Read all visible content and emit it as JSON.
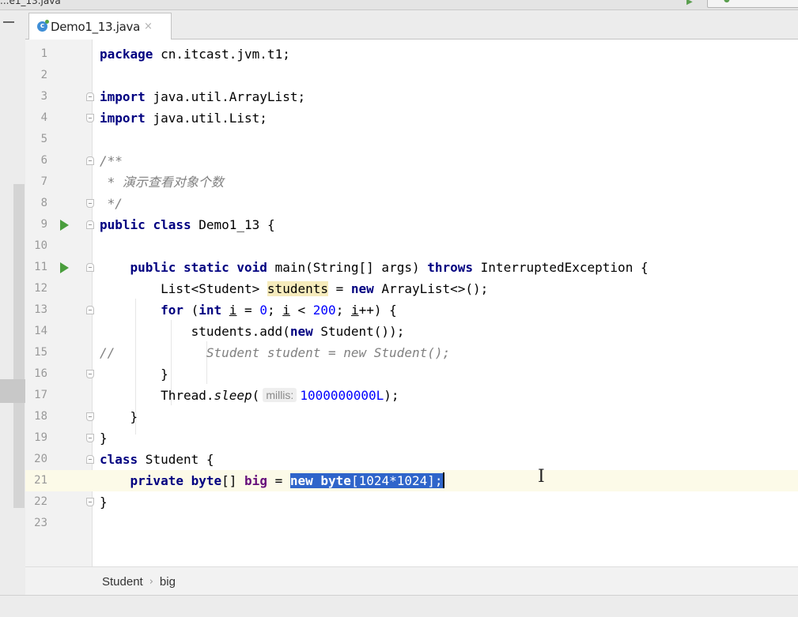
{
  "window": {
    "title_fragment": "...e1_13.java"
  },
  "tab": {
    "file_icon_letter": "c",
    "label": "Demo1_13.java",
    "close_glyph": "×"
  },
  "editor": {
    "current_line": 21,
    "lines": [
      {
        "n": "1"
      },
      {
        "n": "2"
      },
      {
        "n": "3"
      },
      {
        "n": "4"
      },
      {
        "n": "5"
      },
      {
        "n": "6"
      },
      {
        "n": "7"
      },
      {
        "n": "8"
      },
      {
        "n": "9"
      },
      {
        "n": "10"
      },
      {
        "n": "11"
      },
      {
        "n": "12"
      },
      {
        "n": "13"
      },
      {
        "n": "14"
      },
      {
        "n": "15"
      },
      {
        "n": "16"
      },
      {
        "n": "17"
      },
      {
        "n": "18"
      },
      {
        "n": "19"
      },
      {
        "n": "20"
      },
      {
        "n": "21"
      },
      {
        "n": "22"
      },
      {
        "n": "23"
      }
    ],
    "code": {
      "l1_kw": "package",
      "l1_rest": " cn.itcast.jvm.t1;",
      "l3_kw": "import",
      "l3_rest": " java.util.ArrayList;",
      "l4_kw": "import",
      "l4_rest": " java.util.List;",
      "l6": "/**",
      "l7": " * 演示查看对象个数",
      "l8": " */",
      "l9_kw1": "public",
      "l9_kw2": "class",
      "l9_rest": " Demo1_13 {",
      "l11_indent": "    ",
      "l11_kw1": "public",
      "l11_kw2": "static",
      "l11_kw3": "void",
      "l11_mid": " main(String[] args) ",
      "l11_kw4": "throws",
      "l11_rest": " InterruptedException {",
      "l12_pre": "        List<Student> ",
      "l12_var": "students",
      "l12_mid": " = ",
      "l12_kw": "new",
      "l12_rest": " ArrayList<>();",
      "l13_pre": "        ",
      "l13_kw1": "for",
      "l13_a": " (",
      "l13_kw2": "int",
      "l13_b": " ",
      "l13_i1": "i",
      "l13_c": " = ",
      "l13_n1": "0",
      "l13_d": "; ",
      "l13_i2": "i",
      "l13_e": " < ",
      "l13_n2": "200",
      "l13_f": "; ",
      "l13_i3": "i",
      "l13_g": "++) {",
      "l14_pre": "            students.add(",
      "l14_kw": "new",
      "l14_rest": " Student());",
      "l15": "//            Student student = new Student();",
      "l16": "        }",
      "l17_pre": "        Thread.",
      "l17_method": "sleep",
      "l17_open": "(",
      "l17_hint": "millis:",
      "l17_num": "1000000000L",
      "l17_rest": ");",
      "l18": "    }",
      "l19": "}",
      "l20_kw": "class",
      "l20_rest": " Student {",
      "l21_pre": "    ",
      "l21_kw1": "private",
      "l21_kw2": "byte",
      "l21_mid": "[] ",
      "l21_fld": "big",
      "l21_eq": " = ",
      "l21_sel_kw1": "new",
      "l21_sel_sp": " ",
      "l21_sel_kw2": "byte",
      "l21_sel_a": "[",
      "l21_sel_n1": "1024",
      "l21_sel_b": "*",
      "l21_sel_n2": "1024",
      "l21_sel_c": "];",
      "l22": "}"
    }
  },
  "breadcrumb": {
    "items": [
      "Student",
      "big"
    ],
    "separator": "›"
  },
  "colors": {
    "keyword": "#000080",
    "number": "#0000ff",
    "comment": "#808080",
    "field": "#660e7a",
    "selection": "#2f65ca",
    "current_line": "#fcfae8",
    "run_icon": "#4a9e3d"
  }
}
